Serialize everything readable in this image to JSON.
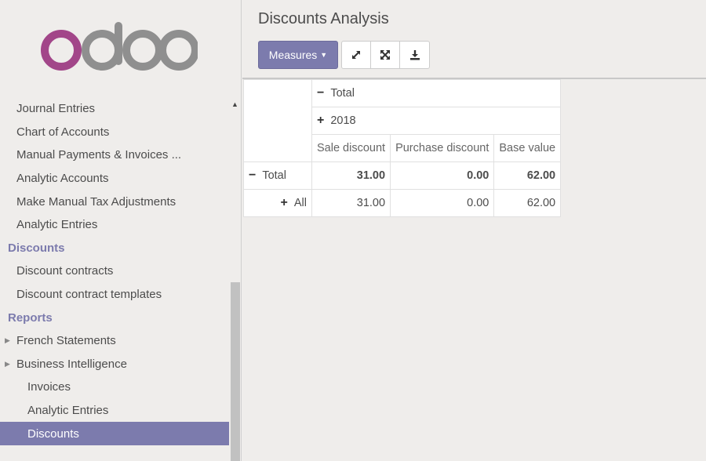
{
  "sidebar": {
    "logo_text": "odoo",
    "items": [
      {
        "type": "item",
        "level": 1,
        "label": "Journal Entries"
      },
      {
        "type": "item",
        "level": 1,
        "label": "Chart of Accounts"
      },
      {
        "type": "item",
        "level": 1,
        "label": "Manual Payments & Invoices ..."
      },
      {
        "type": "item",
        "level": 1,
        "label": "Analytic Accounts"
      },
      {
        "type": "item",
        "level": 1,
        "label": "Make Manual Tax Adjustments"
      },
      {
        "type": "item",
        "level": 1,
        "label": "Analytic Entries"
      },
      {
        "type": "section",
        "label": "Discounts"
      },
      {
        "type": "item",
        "level": 1,
        "label": "Discount contracts"
      },
      {
        "type": "item",
        "level": 1,
        "label": "Discount contract templates"
      },
      {
        "type": "section",
        "label": "Reports"
      },
      {
        "type": "caret",
        "level": 1,
        "label": "French Statements"
      },
      {
        "type": "caret",
        "level": 1,
        "label": "Business Intelligence"
      },
      {
        "type": "item",
        "level": 2,
        "label": "Invoices"
      },
      {
        "type": "item",
        "level": 2,
        "label": "Analytic Entries"
      },
      {
        "type": "item",
        "level": 2,
        "label": "Discounts",
        "active": true
      }
    ]
  },
  "main": {
    "title": "Discounts Analysis",
    "measures_label": "Measures",
    "toolbar_icons": [
      "flip-axis-icon",
      "expand-all-icon",
      "download-icon"
    ]
  },
  "pivot": {
    "col_header_total": "Total",
    "col_header_year": "2018",
    "measures": [
      "Sale discount",
      "Purchase discount",
      "Base value"
    ],
    "rows": [
      {
        "label": "Total",
        "symbol": "−",
        "values": [
          "31.00",
          "0.00",
          "62.00"
        ]
      },
      {
        "label": "All",
        "symbol": "+",
        "values": [
          "31.00",
          "0.00",
          "62.00"
        ]
      }
    ]
  },
  "colors": {
    "accent": "#7c7bad",
    "logo_o": "#a24689",
    "logo_doo": "#8f8f8f"
  }
}
